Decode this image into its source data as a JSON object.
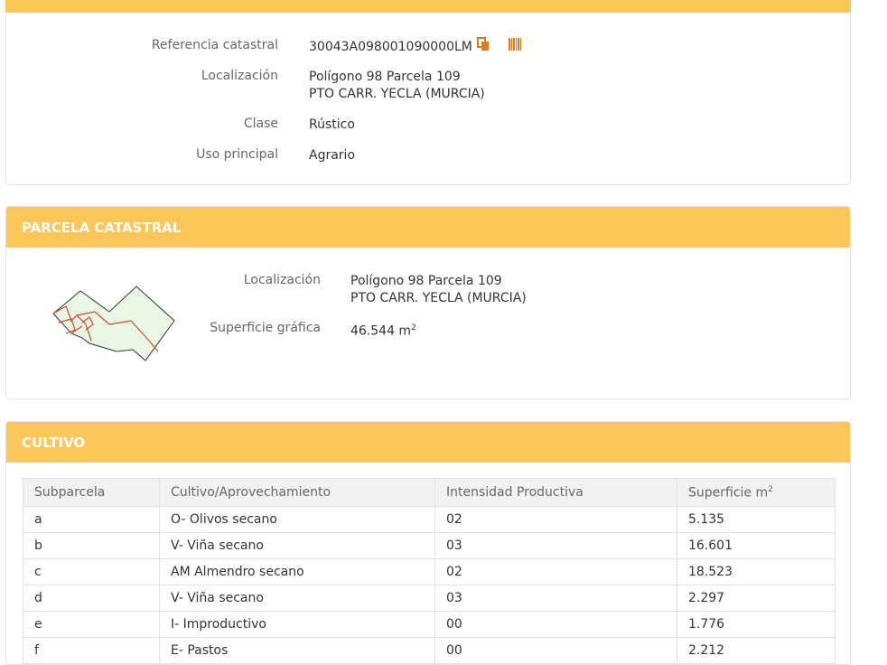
{
  "datos": {
    "referencia_label": "Referencia catastral",
    "referencia_value": "30043A098001090000LM",
    "localizacion_label": "Localización",
    "localizacion_line1": "Polígono 98 Parcela 109",
    "localizacion_line2": "PTO CARR. YECLA (MURCIA)",
    "clase_label": "Clase",
    "clase_value": "Rústico",
    "uso_label": "Uso principal",
    "uso_value": "Agrario"
  },
  "parcela": {
    "title": "PARCELA CATASTRAL",
    "localizacion_label": "Localización",
    "localizacion_line1": "Polígono 98 Parcela 109",
    "localizacion_line2": "PTO CARR. YECLA (MURCIA)",
    "superficie_label": "Superficie gráfica",
    "superficie_value": "46.544 m",
    "superficie_unit_sup": "2"
  },
  "cultivo": {
    "title": "CULTIVO",
    "headers": [
      "Subparcela",
      "Cultivo/Aprovechamiento",
      "Intensidad Productiva",
      "Superficie m"
    ],
    "header_sup": "2",
    "rows": [
      [
        "a",
        "O- Olivos secano",
        "02",
        "5.135"
      ],
      [
        "b",
        "V- Viña secano",
        "03",
        "16.601"
      ],
      [
        "c",
        "AM Almendro secano",
        "02",
        "18.523"
      ],
      [
        "d",
        "V- Viña secano",
        "03",
        "2.297"
      ],
      [
        "e",
        "I- Improductivo",
        "00",
        "1.776"
      ],
      [
        "f",
        "E- Pastos",
        "00",
        "2.212"
      ]
    ]
  },
  "icons": {
    "copy": "copy-icon",
    "barcode": "barcode-icon"
  },
  "colors": {
    "header_bg": "#fbc758",
    "accent": "#e07b1a",
    "parcel_fill": "#e8f8e4",
    "parcel_line": "#d9472b"
  }
}
